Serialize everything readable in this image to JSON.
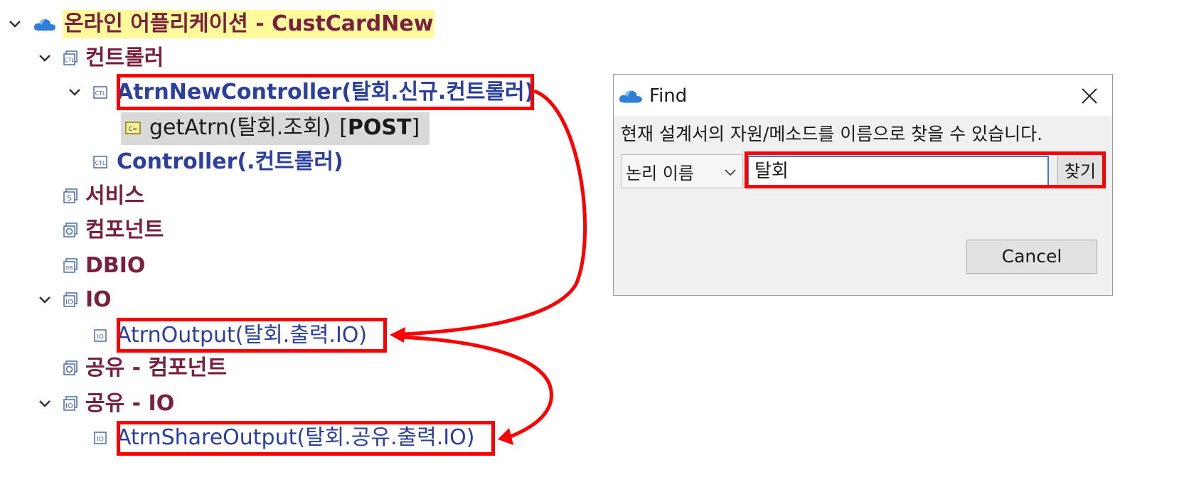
{
  "tree": {
    "root": {
      "label": "온라인 어플리케이션 - CustCardNew",
      "icon": "cloud-icon"
    },
    "controllers": {
      "label": "컨트롤러",
      "icon": "controller-folder-icon"
    },
    "atrn_new_controller": {
      "label": "AtrnNewController(탈회.신규.컨트롤러)",
      "icon": "controller-icon"
    },
    "get_atrn": {
      "name": "getAtrn(탈회.조회)",
      "bracket_open": "[",
      "method": "POST",
      "bracket_close": "]",
      "icon": "method-icon"
    },
    "controller": {
      "label": "Controller(.컨트롤러)",
      "icon": "controller-icon"
    },
    "services": {
      "label": "서비스",
      "icon": "service-folder-icon"
    },
    "components": {
      "label": "컴포넌트",
      "icon": "component-folder-icon"
    },
    "dbio": {
      "label": "DBIO",
      "icon": "dbio-folder-icon"
    },
    "io": {
      "label": "IO",
      "icon": "io-folder-icon"
    },
    "atrn_output": {
      "label": "AtrnOutput(탈회.출력.IO)",
      "icon": "io-icon"
    },
    "shared_components": {
      "label": "공유 - 컴포넌트",
      "icon": "component-folder-icon"
    },
    "shared_io": {
      "label": "공유 - IO",
      "icon": "io-folder-icon"
    },
    "atrn_share_output": {
      "label": "AtrnShareOutput(탈회.공유.출력.IO)",
      "icon": "io-icon"
    }
  },
  "find_dialog": {
    "title": "Find",
    "description": "현재 설계서의 자원/메소드를 이름으로 찾을 수 있습니다.",
    "search_type": "논리 이름",
    "search_value": "탈회",
    "find_button": "찾기",
    "cancel_button": "Cancel"
  },
  "colors": {
    "highlight": "#ff0000",
    "category_text": "#7a1f3d",
    "item_text": "#2a3f9e",
    "root_background": "#fffa9c",
    "selection_background": "#d9d9d9"
  }
}
